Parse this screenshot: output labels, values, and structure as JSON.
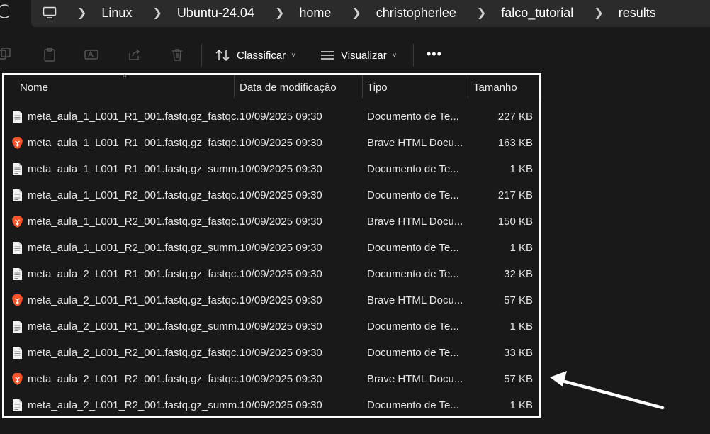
{
  "breadcrumb": [
    "Linux",
    "Ubuntu-24.04",
    "home",
    "christopherlee",
    "falco_tutorial",
    "results"
  ],
  "toolbar": {
    "sort_label": "Classificar",
    "view_label": "Visualizar",
    "more_label": "•••"
  },
  "columns": {
    "name": "Nome",
    "date": "Data de modificação",
    "type": "Tipo",
    "size": "Tamanho"
  },
  "files": [
    {
      "name": "meta_aula_1_L001_R1_001.fastq.gz_fastqc...",
      "date": "10/09/2025 09:30",
      "type": "Documento de Te...",
      "size": "227 KB",
      "icon": "text-file-icon"
    },
    {
      "name": "meta_aula_1_L001_R1_001.fastq.gz_fastqc...",
      "date": "10/09/2025 09:30",
      "type": "Brave HTML Docu...",
      "size": "163 KB",
      "icon": "brave-icon"
    },
    {
      "name": "meta_aula_1_L001_R1_001.fastq.gz_summ...",
      "date": "10/09/2025 09:30",
      "type": "Documento de Te...",
      "size": "1 KB",
      "icon": "text-file-icon"
    },
    {
      "name": "meta_aula_1_L001_R2_001.fastq.gz_fastqc...",
      "date": "10/09/2025 09:30",
      "type": "Documento de Te...",
      "size": "217 KB",
      "icon": "text-file-icon"
    },
    {
      "name": "meta_aula_1_L001_R2_001.fastq.gz_fastqc...",
      "date": "10/09/2025 09:30",
      "type": "Brave HTML Docu...",
      "size": "150 KB",
      "icon": "brave-icon"
    },
    {
      "name": "meta_aula_1_L001_R2_001.fastq.gz_summ...",
      "date": "10/09/2025 09:30",
      "type": "Documento de Te...",
      "size": "1 KB",
      "icon": "text-file-icon"
    },
    {
      "name": "meta_aula_2_L001_R1_001.fastq.gz_fastqc...",
      "date": "10/09/2025 09:30",
      "type": "Documento de Te...",
      "size": "32 KB",
      "icon": "text-file-icon"
    },
    {
      "name": "meta_aula_2_L001_R1_001.fastq.gz_fastqc...",
      "date": "10/09/2025 09:30",
      "type": "Brave HTML Docu...",
      "size": "57 KB",
      "icon": "brave-icon"
    },
    {
      "name": "meta_aula_2_L001_R1_001.fastq.gz_summ...",
      "date": "10/09/2025 09:30",
      "type": "Documento de Te...",
      "size": "1 KB",
      "icon": "text-file-icon"
    },
    {
      "name": "meta_aula_2_L001_R2_001.fastq.gz_fastqc...",
      "date": "10/09/2025 09:30",
      "type": "Documento de Te...",
      "size": "33 KB",
      "icon": "text-file-icon"
    },
    {
      "name": "meta_aula_2_L001_R2_001.fastq.gz_fastqc...",
      "date": "10/09/2025 09:30",
      "type": "Brave HTML Docu...",
      "size": "57 KB",
      "icon": "brave-icon"
    },
    {
      "name": "meta_aula_2_L001_R2_001.fastq.gz_summ...",
      "date": "10/09/2025 09:30",
      "type": "Documento de Te...",
      "size": "1 KB",
      "icon": "text-file-icon"
    }
  ],
  "colors": {
    "background": "#191919",
    "address_bar": "#2b2b2b",
    "highlight_border": "#ffffff",
    "brave_orange": "#fb542b"
  }
}
